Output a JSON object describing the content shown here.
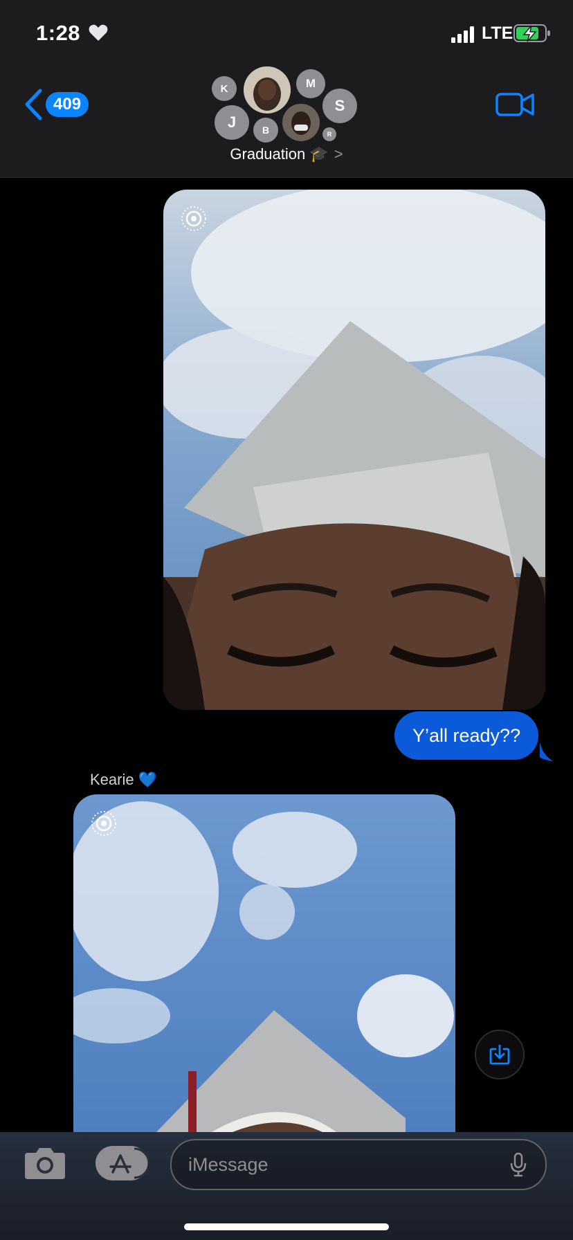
{
  "status_bar": {
    "time": "1:28",
    "network": "LTE"
  },
  "header": {
    "back_count": "409",
    "group_name": "Graduation 🎓",
    "avatars": [
      {
        "initial": "K"
      },
      {
        "initial": "M"
      },
      {
        "initial": "S"
      },
      {
        "initial": "J"
      },
      {
        "initial": "B"
      },
      {
        "initial": "R"
      }
    ]
  },
  "messages": {
    "sent_text": "Y’all ready??",
    "sender_name": "Kearie 💙"
  },
  "input": {
    "placeholder": "iMessage"
  },
  "icons": {
    "back": "chevron-left-icon",
    "video": "video-camera-icon",
    "live_photo": "live-photo-icon",
    "save": "save-download-icon",
    "camera": "camera-icon",
    "apps": "app-store-icon",
    "mic": "microphone-icon"
  },
  "colors": {
    "accent": "#0a84ff",
    "sent_bubble": "#0b5ad9",
    "header_bg": "#1c1c1e",
    "battery_charge": "#30d158"
  }
}
